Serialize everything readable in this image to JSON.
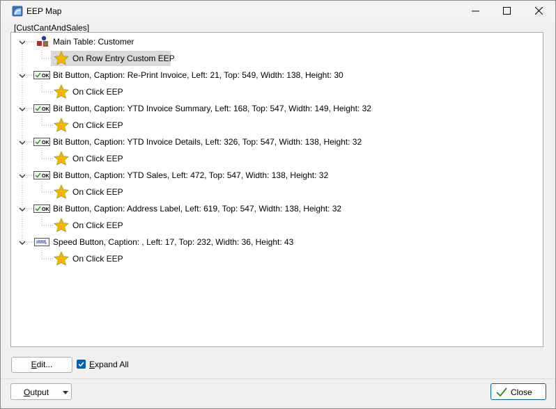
{
  "window": {
    "title": "EEP Map",
    "icon": "app-map-icon",
    "controls": [
      "minimize-icon",
      "maximize-icon",
      "close-icon"
    ]
  },
  "form_caption": "[CustCantAndSales]",
  "tree": {
    "nodes": [
      {
        "label": "Main Table: Customer",
        "icon": "table-icon",
        "child": {
          "label": "On Row Entry Custom EEP",
          "icon": "star-icon",
          "selected": true
        }
      },
      {
        "label": "Bit Button, Caption: Re-Print Invoice, Left: 21, Top: 549, Width: 138, Height: 30",
        "icon": "ok-button-icon",
        "child": {
          "label": "On Click EEP",
          "icon": "star-icon"
        }
      },
      {
        "label": "Bit Button, Caption: YTD Invoice Summary, Left: 168, Top: 547, Width: 149, Height: 32",
        "icon": "ok-button-icon",
        "child": {
          "label": "On Click EEP",
          "icon": "star-icon"
        }
      },
      {
        "label": "Bit Button, Caption: YTD Invoice Details, Left: 326, Top: 547, Width: 138, Height: 32",
        "icon": "ok-button-icon",
        "child": {
          "label": "On Click EEP",
          "icon": "star-icon"
        }
      },
      {
        "label": "Bit Button, Caption: YTD Sales, Left: 472, Top: 547, Width: 138, Height: 32",
        "icon": "ok-button-icon",
        "child": {
          "label": "On Click EEP",
          "icon": "star-icon"
        }
      },
      {
        "label": "Bit Button, Caption: Address Label, Left: 619, Top: 547, Width: 138, Height: 32",
        "icon": "ok-button-icon",
        "child": {
          "label": "On Click EEP",
          "icon": "star-icon"
        }
      },
      {
        "label": "Speed Button, Caption: , Left: 17, Top: 232, Width: 36, Height: 43",
        "icon": "speed-button-icon",
        "child": {
          "label": "On Click EEP",
          "icon": "star-icon"
        }
      }
    ]
  },
  "buttons": {
    "edit": {
      "first": "E",
      "rest": "dit..."
    },
    "expand_all": {
      "first": "E",
      "rest": "xpand All",
      "checked": true
    },
    "output": {
      "first": "O",
      "rest": "utput"
    },
    "close": "Close"
  },
  "colors": {
    "accent": "#005fb8",
    "selected_row": "#d9d9d9",
    "star": "#f5b800"
  }
}
